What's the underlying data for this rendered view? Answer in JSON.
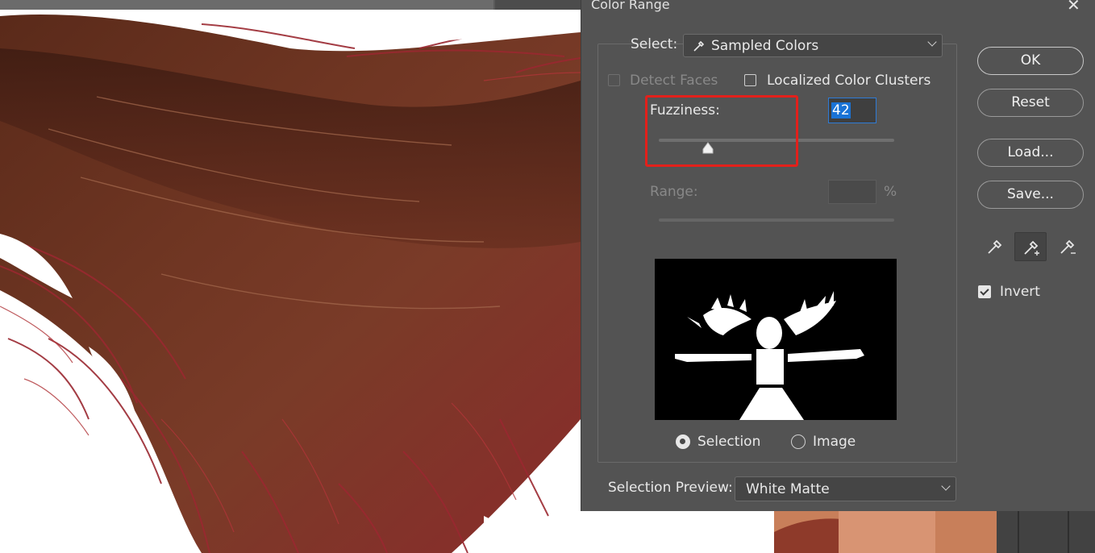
{
  "dialog": {
    "title": "Color Range",
    "close_glyph": "✕",
    "select": {
      "label": "Select:",
      "value": "Sampled Colors",
      "icon": "eyedropper-icon"
    },
    "detect_faces": {
      "label": "Detect Faces",
      "checked": false,
      "enabled": false
    },
    "localized_clusters": {
      "label": "Localized Color Clusters",
      "checked": false
    },
    "fuzziness": {
      "label": "Fuzziness:",
      "value": "42"
    },
    "range": {
      "label": "Range:",
      "unit": "%",
      "enabled": false
    },
    "view_options": [
      {
        "label": "Selection",
        "selected": true
      },
      {
        "label": "Image",
        "selected": false
      }
    ],
    "selection_preview": {
      "label": "Selection Preview:",
      "value": "White Matte"
    },
    "buttons": {
      "ok": "OK",
      "reset": "Reset",
      "load": "Load...",
      "save": "Save..."
    },
    "eyedroppers": [
      "eyedropper-icon",
      "add-to-sample-eyedropper-icon",
      "subtract-from-sample-eyedropper-icon"
    ],
    "invert": {
      "label": "Invert",
      "checked": true
    }
  },
  "colors": {
    "dialog_bg": "#535353",
    "highlight": "#e3201b",
    "accent": "#1a73d6",
    "hair_dark": "#4a2015",
    "hair_red": "#9a2830"
  }
}
